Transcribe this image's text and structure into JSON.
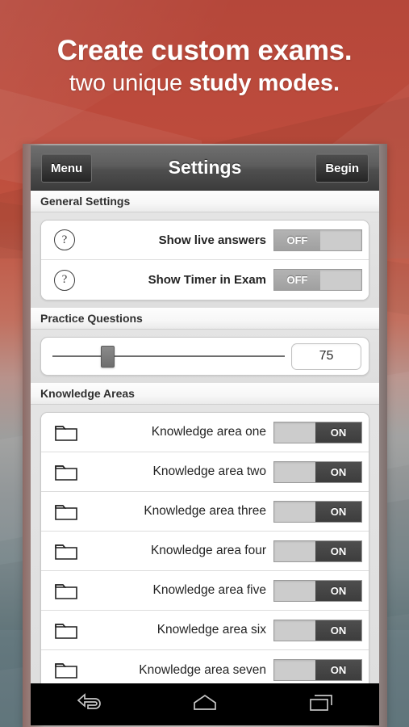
{
  "promo": {
    "line1": "Create custom exams.",
    "line2_plain": "two unique ",
    "line2_bold": "study modes."
  },
  "colors": {
    "promo_bg_top": "#b5473a",
    "promo_bg_bottom": "#5b7077",
    "actionbar": "#4f4f4f",
    "toggle_on_knob": "#3d3d3d",
    "toggle_off_knob": "#a0a0a0",
    "toggle_track": "#cccccc",
    "navbar": "#000000"
  },
  "actionbar": {
    "menu_label": "Menu",
    "title": "Settings",
    "begin_label": "Begin"
  },
  "sections": {
    "general": {
      "header": "General Settings",
      "rows": [
        {
          "icon": "question-mark-icon",
          "label": "Show live answers",
          "toggle": "OFF"
        },
        {
          "icon": "question-mark-icon",
          "label": "Show Timer in Exam",
          "toggle": "OFF"
        }
      ]
    },
    "practice": {
      "header": "Practice Questions",
      "slider": {
        "value": "75",
        "thumb_percent": 23
      }
    },
    "knowledge": {
      "header": "Knowledge Areas",
      "rows": [
        {
          "icon": "folder-icon",
          "label": "Knowledge area one",
          "toggle": "ON"
        },
        {
          "icon": "folder-icon",
          "label": "Knowledge area two",
          "toggle": "ON"
        },
        {
          "icon": "folder-icon",
          "label": "Knowledge area three",
          "toggle": "ON"
        },
        {
          "icon": "folder-icon",
          "label": "Knowledge area four",
          "toggle": "ON"
        },
        {
          "icon": "folder-icon",
          "label": "Knowledge area five",
          "toggle": "ON"
        },
        {
          "icon": "folder-icon",
          "label": "Knowledge area six",
          "toggle": "ON"
        },
        {
          "icon": "folder-icon",
          "label": "Knowledge area seven",
          "toggle": "ON"
        }
      ]
    }
  },
  "navbar": {
    "back": "back-icon",
    "home": "home-icon",
    "recents": "recents-icon"
  },
  "glyphs": {
    "question": "?"
  }
}
